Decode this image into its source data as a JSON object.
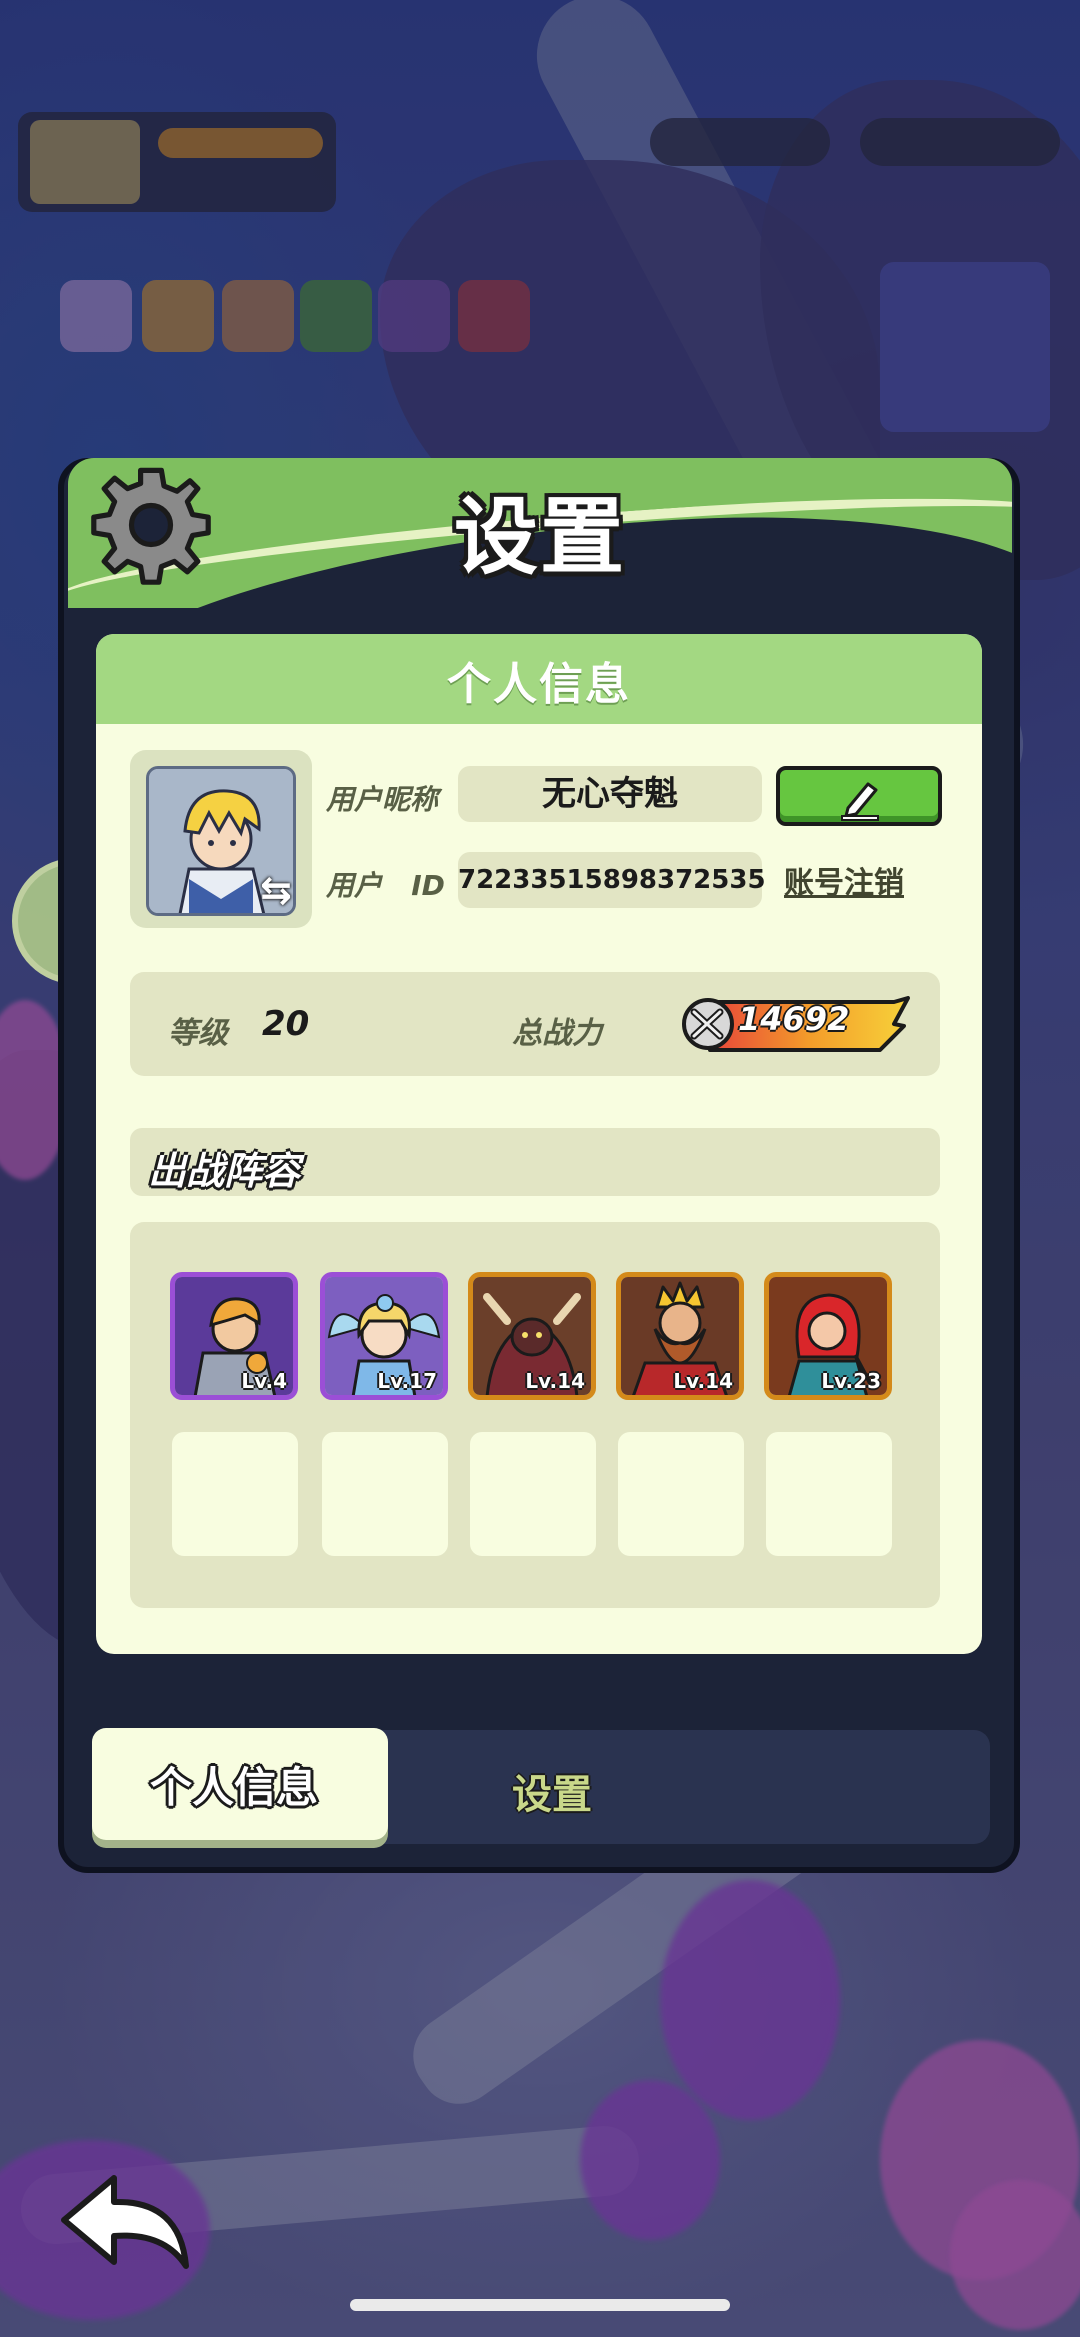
{
  "panel": {
    "title": "设置"
  },
  "profile": {
    "header": "个人信息",
    "nickname_label": "用户昵称",
    "nickname": "无心夺魁",
    "id_label": "用户   ID",
    "user_id": "72233515898372535",
    "unregister_label": "账号注销"
  },
  "stats": {
    "level_label": "等级",
    "level": "20",
    "power_label": "总战力",
    "power": "14692"
  },
  "lineup": {
    "title": "出战阵容",
    "heroes": [
      {
        "level": "Lv.4",
        "rarity": "epic",
        "portrait": "blonde-armored-knight"
      },
      {
        "level": "Lv.17",
        "rarity": "epic",
        "portrait": "fairy-girl"
      },
      {
        "level": "Lv.14",
        "rarity": "legendary",
        "portrait": "horned-beast"
      },
      {
        "level": "Lv.14",
        "rarity": "legendary",
        "portrait": "crowned-king"
      },
      {
        "level": "Lv.23",
        "rarity": "legendary",
        "portrait": "red-haired-archer"
      }
    ],
    "empty_slots": 5
  },
  "tabs": [
    {
      "label": "个人信息",
      "active": true
    },
    {
      "label": "设置",
      "active": false
    }
  ],
  "colors": {
    "header_green": "#7fbf5f",
    "card_cream": "#f8fde0",
    "epic_border": "#9b4fd6",
    "legendary_border": "#d48a1a",
    "edit_button": "#66c640"
  }
}
